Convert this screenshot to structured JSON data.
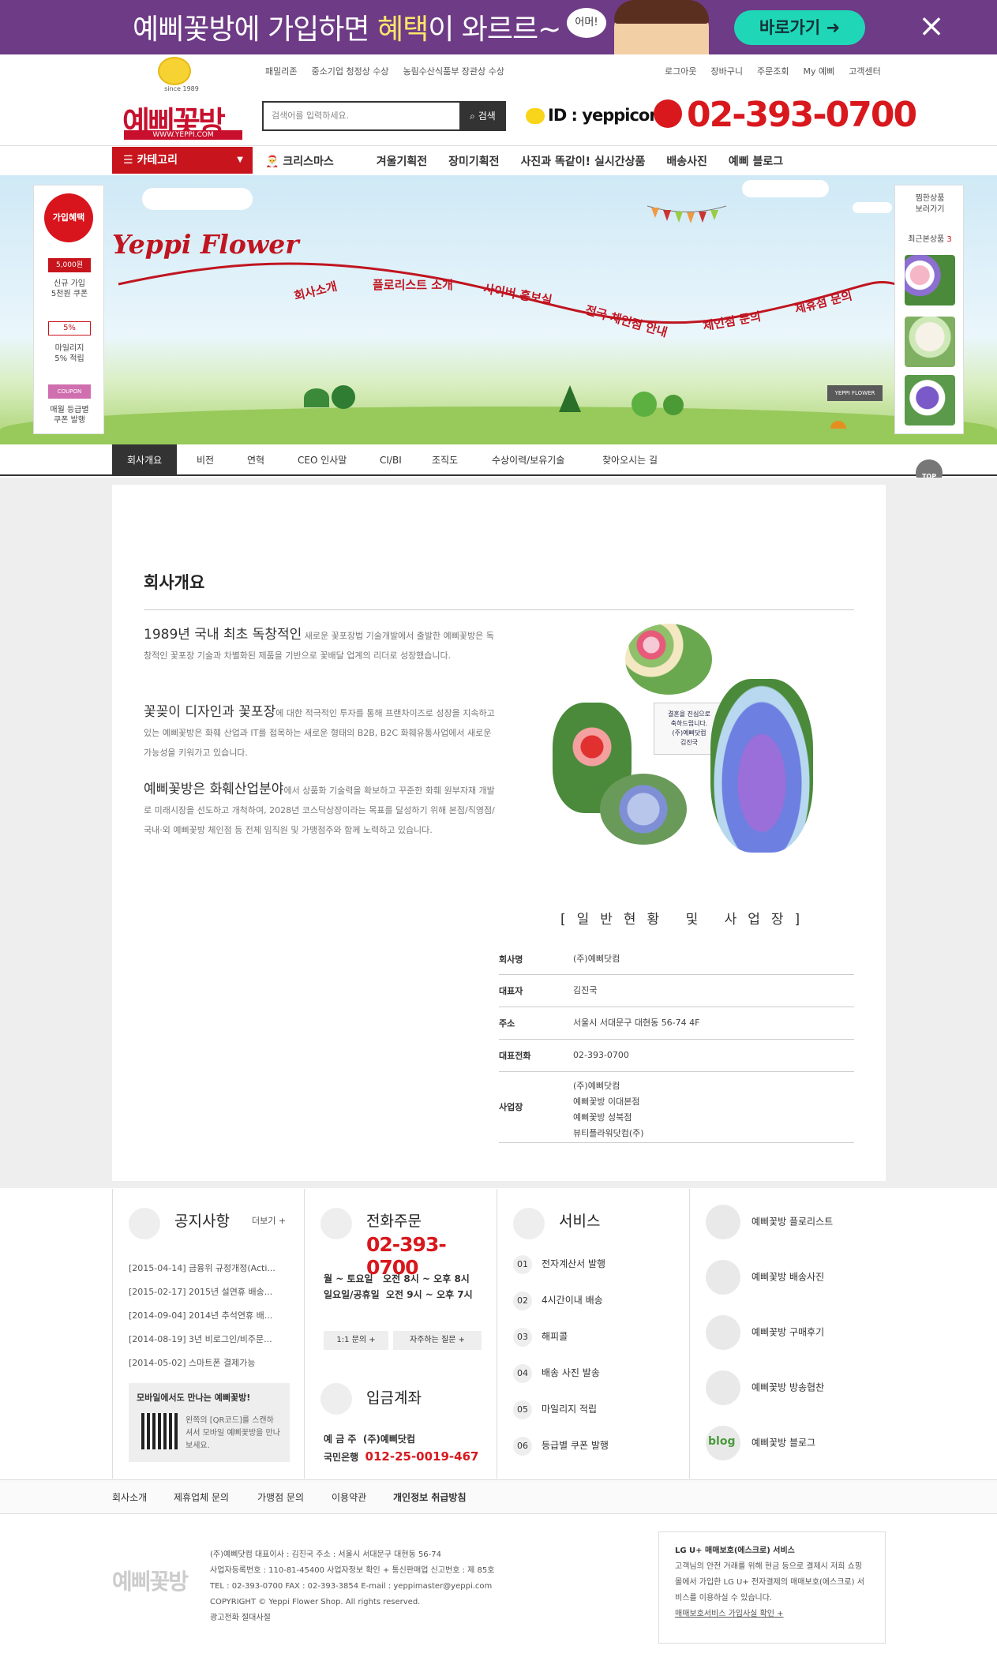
{
  "banner": {
    "text_a": "예삐꽃방에 가입하면 ",
    "text_b": "혜택",
    "text_c": "이 와르르~",
    "bubble": "어머!",
    "button": "바로가기",
    "close": "×"
  },
  "logo": {
    "since": "since 1989",
    "name": "예삐꽃방",
    "url": "WWW.YEPPI.COM"
  },
  "awards": [
    "패밀리존",
    "중소기업 청정상 수상",
    "농림수산식품부 장관상 수상"
  ],
  "toplinks": [
    "로그아웃",
    "장바구니",
    "주문조회",
    "My 예삐",
    "고객센터"
  ],
  "search": {
    "placeholder": "검색어를 입력하세요.",
    "button": "검색"
  },
  "kakao": "ID : yeppicom",
  "phone": "02-393-0700",
  "category": {
    "label": "카테고리",
    "arrow": "▼"
  },
  "nav": [
    "크리스마스",
    "겨울기획전",
    "장미기획전",
    "사진과 똑같이! 실시간상품",
    "배송사진",
    "예삐 블로그"
  ],
  "hero": {
    "title": "Yeppi Flower",
    "links": [
      "회사소개",
      "플로리스트 소개",
      "사이버 홍보실",
      "전국 체인점 안내",
      "체인점 문의",
      "제휴점 문의"
    ],
    "sign": "YEPPI FLOWER"
  },
  "leftbox": {
    "circle": "가입혜택",
    "items": [
      "신규 가입\n5천원 쿠폰",
      "마일리지\n5% 적립",
      "매월 등급별\n쿠폰 발행"
    ],
    "badges": [
      "5,000원",
      "5%",
      "COUPON"
    ]
  },
  "rightbox": {
    "wish": "찜한상품\n보러가기",
    "recent_label": "최근본상품",
    "recent_count": "3"
  },
  "subnav": [
    "회사개요",
    "비전",
    "연혁",
    "CEO 인사말",
    "CI/BI",
    "조직도",
    "수상이력/보유기술",
    "찾아오시는 길"
  ],
  "top_button": "TOP",
  "page": {
    "title": "회사개요",
    "paras": [
      {
        "lead": "1989년 국내 최초 독창적인",
        "body": " 새로운 꽃포장법 기술개발에서 출발한 예삐꽃방은 독창적인 꽃포장 기술과 차별화된 제품을 기반으로 꽃배달 업계의 리더로 성장했습니다."
      },
      {
        "lead": "꽃꽂이 디자인과 꽃포장",
        "body": "에 대한 적극적인 투자를 통해 프랜차이즈로 성장을 지속하고 있는 예삐꽃방은 화훼 산업과 IT를 접목하는 새로운 형태의 B2B, B2C 화훼유통사업에서 새로운 가능성을 키워가고 있습니다."
      },
      {
        "lead": "예삐꽃방은 화훼산업분야",
        "body": "에서 상품화 기술력을 확보하고 꾸준한 화훼 원부자재 개발로 미래시장을 선도하고 개척하여, 2028년 코스닥상장이라는 목표를 달성하기 위해 본점/직영점/국내·외 예삐꽃방 체인점 등 전체 임직원 및 가맹점주와 함께 노력하고 있습니다."
      }
    ],
    "card_text": "결혼을 진심으로\n축하드립니다.\n(주)예삐닷컴\n김진국",
    "section_title": "[일반현황 및 사업장]",
    "table": [
      {
        "k": "회사명",
        "v": [
          "(주)예삐닷컴"
        ]
      },
      {
        "k": "대표자",
        "v": [
          "김진국"
        ]
      },
      {
        "k": "주소",
        "v": [
          "서울시 서대문구 대현동 56-74 4F"
        ]
      },
      {
        "k": "대표전화",
        "v": [
          "02-393-0700"
        ]
      },
      {
        "k": "사업장",
        "v": [
          "(주)예삐닷컴",
          "예삐꽃방 이대본점",
          "예삐꽃방 성북점",
          "뷰티플라워닷컴(주)"
        ]
      }
    ]
  },
  "notice": {
    "title": "공지사항",
    "more": "더보기 +",
    "items": [
      "[2015-04-14] 금융위 규정개정(Acti...",
      "[2015-02-17] 2015년 설연휴 배송...",
      "[2014-09-04] 2014년 추석연휴 배...",
      "[2014-08-19] 3년 비로그인/비주문...",
      "[2014-05-02] 스마트폰 결제가능"
    ],
    "mobile_title": "모바일에서도 만나는 예삐꽃방!",
    "mobile_text": "왼쪽의 [QR코드]를 스캔하셔서 모바일 예삐꽃방을 만나보세요."
  },
  "order": {
    "title": "전화주문",
    "phone": "02-393-0700",
    "hours": [
      [
        "월 ~ 토요일",
        "오전 8시 ~ 오후 8시"
      ],
      [
        "일요일/공휴일",
        "오전 9시 ~ 오후 7시"
      ]
    ],
    "btn1": "1:1 문의 +",
    "btn2": "자주하는 질문 +",
    "deposit_title": "입금계좌",
    "holder_label": "예 금 주",
    "holder": "(주)예삐닷컴",
    "bank": "국민은행",
    "account": "012-25-0019-467"
  },
  "service": {
    "title": "서비스",
    "items": [
      [
        "01",
        "전자계산서 발행"
      ],
      [
        "02",
        "4시간이내 배송"
      ],
      [
        "03",
        "해피콜"
      ],
      [
        "04",
        "배송 사진 발송"
      ],
      [
        "05",
        "마일리지 적립"
      ],
      [
        "06",
        "등급별 쿠폰 발행"
      ]
    ]
  },
  "links4": [
    "예삐꽃방 플로리스트",
    "예삐꽃방 배송사진",
    "예삐꽃방 구매후기",
    "예삐꽃방 방송협찬",
    "예삐꽃방 블로그"
  ],
  "blog_badge": "blog",
  "botnav": [
    "회사소개",
    "제휴업체 문의",
    "가맹점 문의",
    "이용약관",
    "개인정보 취급방침"
  ],
  "footer": {
    "logo": "예삐꽃방",
    "lines": [
      "(주)예삐닷컴    대표이사 : 김진국    주소 : 서울시 서대문구 대현동 56-74",
      "사업자등록번호 : 110-81-45400 사업자정보 확인 +    통신판매업 신고번호 : 제 85호",
      "TEL : 02-393-0700    FAX : 02-393-3854    E-mail : yeppimaster@yeppi.com",
      "COPYRIGHT © Yeppi Flower Shop. All rights reserved.",
      "광고전화 절대사절"
    ],
    "escrow_title": "LG U+ 매매보호(에스크로) 서비스",
    "escrow_text": "고객님의 안전 거래를 위해 현금 등으로 결제시 저희 쇼핑몰에서 가입한 LG U+ 전자결제의 매매보호(에스크로) 서비스를 이용하실 수 있습니다.",
    "escrow_link": "매매보호서비스 가입사실 확인 +"
  }
}
